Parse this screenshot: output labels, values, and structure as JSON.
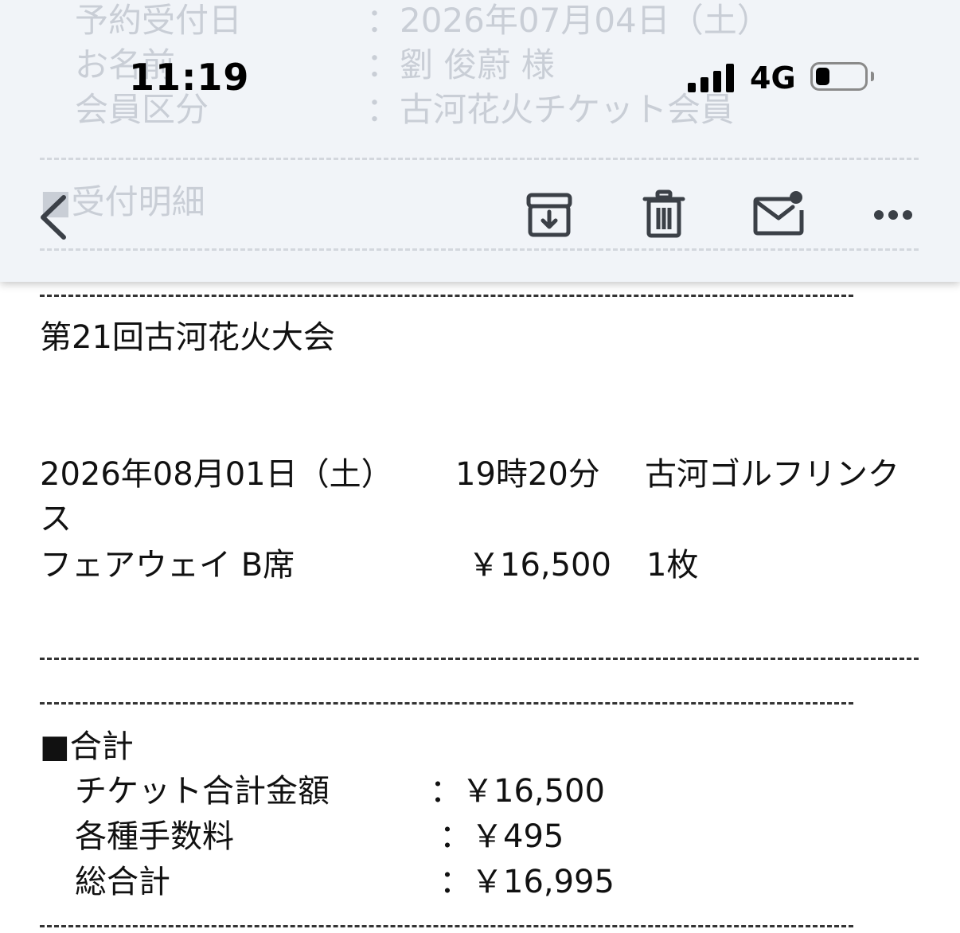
{
  "status_bar": {
    "time": "11:19",
    "network": "4G",
    "battery_level": 0.3
  },
  "toolbar": {
    "icons": [
      "back-chevron-icon",
      "archive-icon",
      "trash-icon",
      "mark-unread-icon",
      "more-icon"
    ]
  },
  "header_ghost": {
    "row1_label": "予約受付日",
    "row1_value": "：2026年07月04日（土）",
    "row2_label": "お名前",
    "row2_value": "：劉 俊蔚 様",
    "row3_label": "会員区分",
    "row3_value": "：古河花火チケット会員",
    "section": "■受付明細"
  },
  "email": {
    "event_name": "第21回古河花火大会",
    "date": "2026年08月01日（土）",
    "time": "19時20分",
    "venue": "古河ゴルフリンク",
    "venue_wrap": "ス",
    "seat": "フェアウェイ B席",
    "seat_price": "￥16,500",
    "seat_qty": "1枚",
    "total_heading": "■合計",
    "totals": [
      {
        "label": "チケット合計金額",
        "value": "：￥16,500"
      },
      {
        "label": "各種手数料",
        "value": "：￥495"
      },
      {
        "label": "総合計",
        "value": "：￥16,995"
      }
    ]
  }
}
